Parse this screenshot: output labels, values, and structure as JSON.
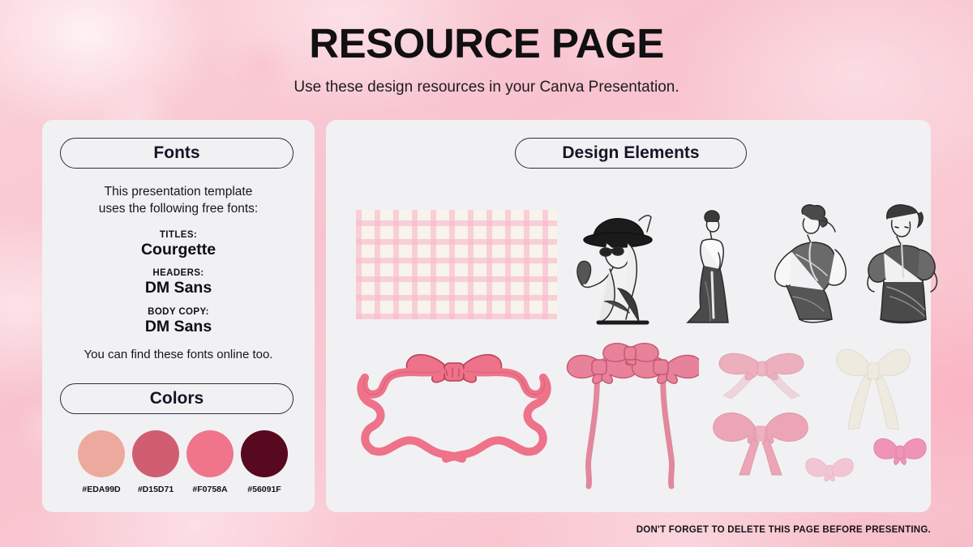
{
  "header": {
    "title": "RESOURCE PAGE",
    "subtitle": "Use these design resources in your Canva Presentation."
  },
  "fonts_panel": {
    "heading": "Fonts",
    "intro": "This presentation template\nuses the following free fonts:",
    "groups": [
      {
        "label": "TITLES:",
        "name": "Courgette"
      },
      {
        "label": "HEADERS:",
        "name": "DM Sans"
      },
      {
        "label": "BODY COPY:",
        "name": "DM Sans"
      }
    ],
    "outro": "You can find these fonts online too."
  },
  "colors_panel": {
    "heading": "Colors",
    "swatches": [
      {
        "code": "#EDA99D",
        "hex": "#EDA99D"
      },
      {
        "code": "#D15D71",
        "hex": "#D15D71"
      },
      {
        "code": "#F0758A",
        "hex": "#F0758A"
      },
      {
        "code": "#56091F",
        "hex": "#56091F"
      }
    ]
  },
  "design_panel": {
    "heading": "Design Elements",
    "elements": [
      {
        "name": "gingham-pattern-swatch",
        "kind": "pattern"
      },
      {
        "name": "fashion-sketch-hat-lady",
        "kind": "illustration"
      },
      {
        "name": "fashion-sketch-gown-lady",
        "kind": "illustration"
      },
      {
        "name": "fashion-sketch-wrap-lady",
        "kind": "illustration"
      },
      {
        "name": "fashion-sketch-puff-sleeve-lady",
        "kind": "illustration"
      },
      {
        "name": "ribbon-bow-frame",
        "kind": "illustration"
      },
      {
        "name": "triple-bow-arch",
        "kind": "illustration"
      },
      {
        "name": "watercolor-bow-sheer-pink",
        "kind": "illustration"
      },
      {
        "name": "watercolor-bow-cream",
        "kind": "illustration"
      },
      {
        "name": "watercolor-bow-loop-pink",
        "kind": "illustration"
      },
      {
        "name": "watercolor-bow-small-pale",
        "kind": "illustration"
      },
      {
        "name": "watercolor-bow-magenta",
        "kind": "illustration"
      }
    ]
  },
  "footer": {
    "note": "DON'T FORGET TO DELETE THIS PAGE BEFORE PRESENTING."
  },
  "theme": {
    "background": "#F8C4CE",
    "panel": "#F1F1F3",
    "outline": "#2D2C41",
    "text": "#121117"
  }
}
